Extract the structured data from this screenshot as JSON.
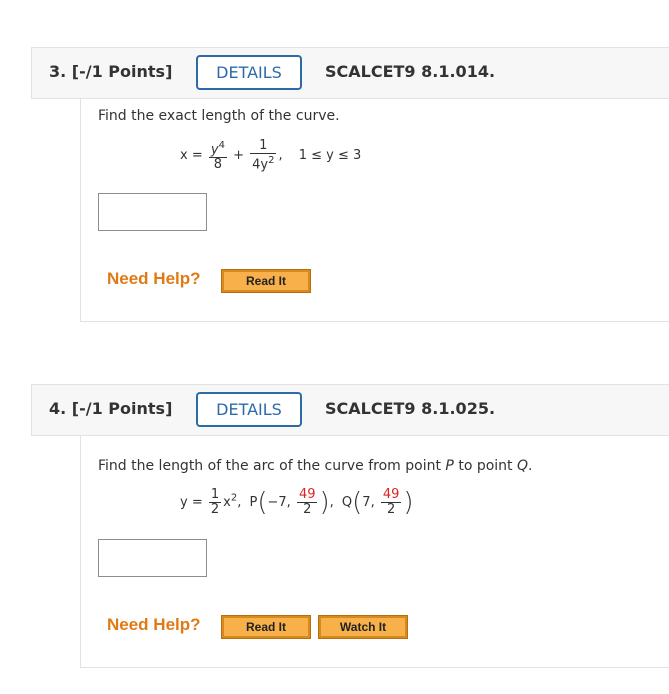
{
  "q3": {
    "number": "3.",
    "points": "[-/1 Points]",
    "details_label": "DETAILS",
    "code": "SCALCET9 8.1.014.",
    "prompt": "Find the exact length of the curve.",
    "eq_lhs": "x =",
    "frac1_num": "y",
    "frac1_num_exp": "4",
    "frac1_den": "8",
    "plus": "+",
    "frac2_num": "1",
    "frac2_den": "4y",
    "frac2_den_exp": "2",
    "comma": ",",
    "range": "1 ≤ y ≤ 3",
    "need_help": "Need Help?",
    "read_it": "Read It"
  },
  "q4": {
    "number": "4.",
    "points": "[-/1 Points]",
    "details_label": "DETAILS",
    "code": "SCALCET9 8.1.025.",
    "prompt_pre": "Find the length of the arc of the curve from point ",
    "p_label": "P",
    "prompt_mid": " to point ",
    "q_label": "Q",
    "prompt_end": ".",
    "eq_lhs": "y =",
    "half_num": "1",
    "half_den": "2",
    "x_var": "x",
    "x_exp": "2",
    "comma": ",",
    "P": "P",
    "p_x": "−7,",
    "p_y_num": "49",
    "p_y_den": "2",
    "Q": "Q",
    "q_x": "7,",
    "q_y_num": "49",
    "q_y_den": "2",
    "need_help": "Need Help?",
    "read_it": "Read It",
    "watch_it": "Watch It"
  }
}
